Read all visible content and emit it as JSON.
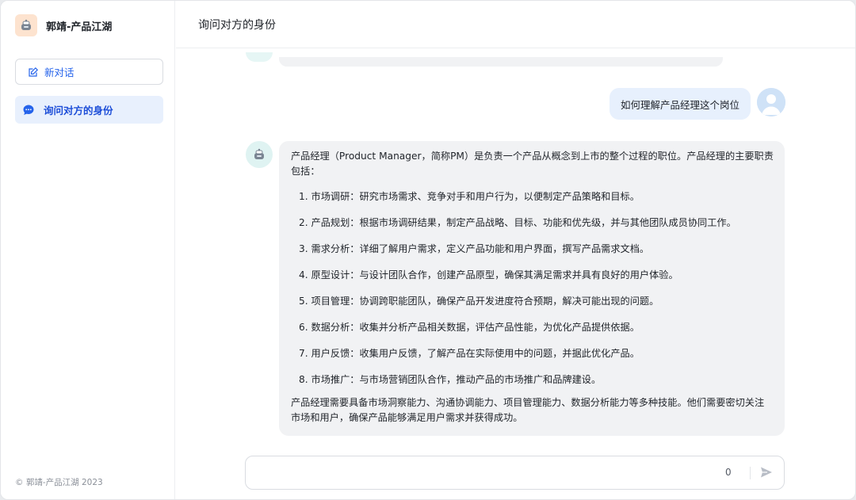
{
  "sidebar": {
    "brand_name": "郭靖-产品江湖",
    "brand_icon": "robot-pot-icon",
    "new_chat_label": "新对话",
    "conversations": [
      {
        "label": "询问对方的身份",
        "active": true
      }
    ],
    "copyright": "© 郭靖-产品江湖 2023"
  },
  "header": {
    "title": "询问对方的身份"
  },
  "messages": {
    "user": {
      "text": "如何理解产品经理这个岗位"
    },
    "assistant": {
      "intro": "产品经理（Product Manager，简称PM）是负责一个产品从概念到上市的整个过程的职位。产品经理的主要职责包括：",
      "items": [
        "1. 市场调研：研究市场需求、竞争对手和用户行为，以便制定产品策略和目标。",
        "2. 产品规划：根据市场调研结果，制定产品战略、目标、功能和优先级，并与其他团队成员协同工作。",
        "3. 需求分析：详细了解用户需求，定义产品功能和用户界面，撰写产品需求文档。",
        "4. 原型设计：与设计团队合作，创建产品原型，确保其满足需求并具有良好的用户体验。",
        "5. 项目管理：协调跨职能团队，确保产品开发进度符合预期，解决可能出现的问题。",
        "6. 数据分析：收集并分析产品相关数据，评估产品性能，为优化产品提供依据。",
        "7. 用户反馈：收集用户反馈，了解产品在实际使用中的问题，并据此优化产品。",
        "8. 市场推广：与市场营销团队合作，推动产品的市场推广和品牌建设。"
      ],
      "outro": "产品经理需要具备市场洞察能力、沟通协调能力、项目管理能力、数据分析能力等多种技能。他们需要密切关注市场和用户，确保产品能够满足用户需求并获得成功。"
    }
  },
  "input": {
    "value": "",
    "placeholder": "",
    "char_count": "0"
  },
  "colors": {
    "accent": "#2563eb",
    "active_item_bg": "#e8f0fd",
    "user_bubble": "#e7f0fd",
    "bot_bubble": "#f1f2f4"
  }
}
